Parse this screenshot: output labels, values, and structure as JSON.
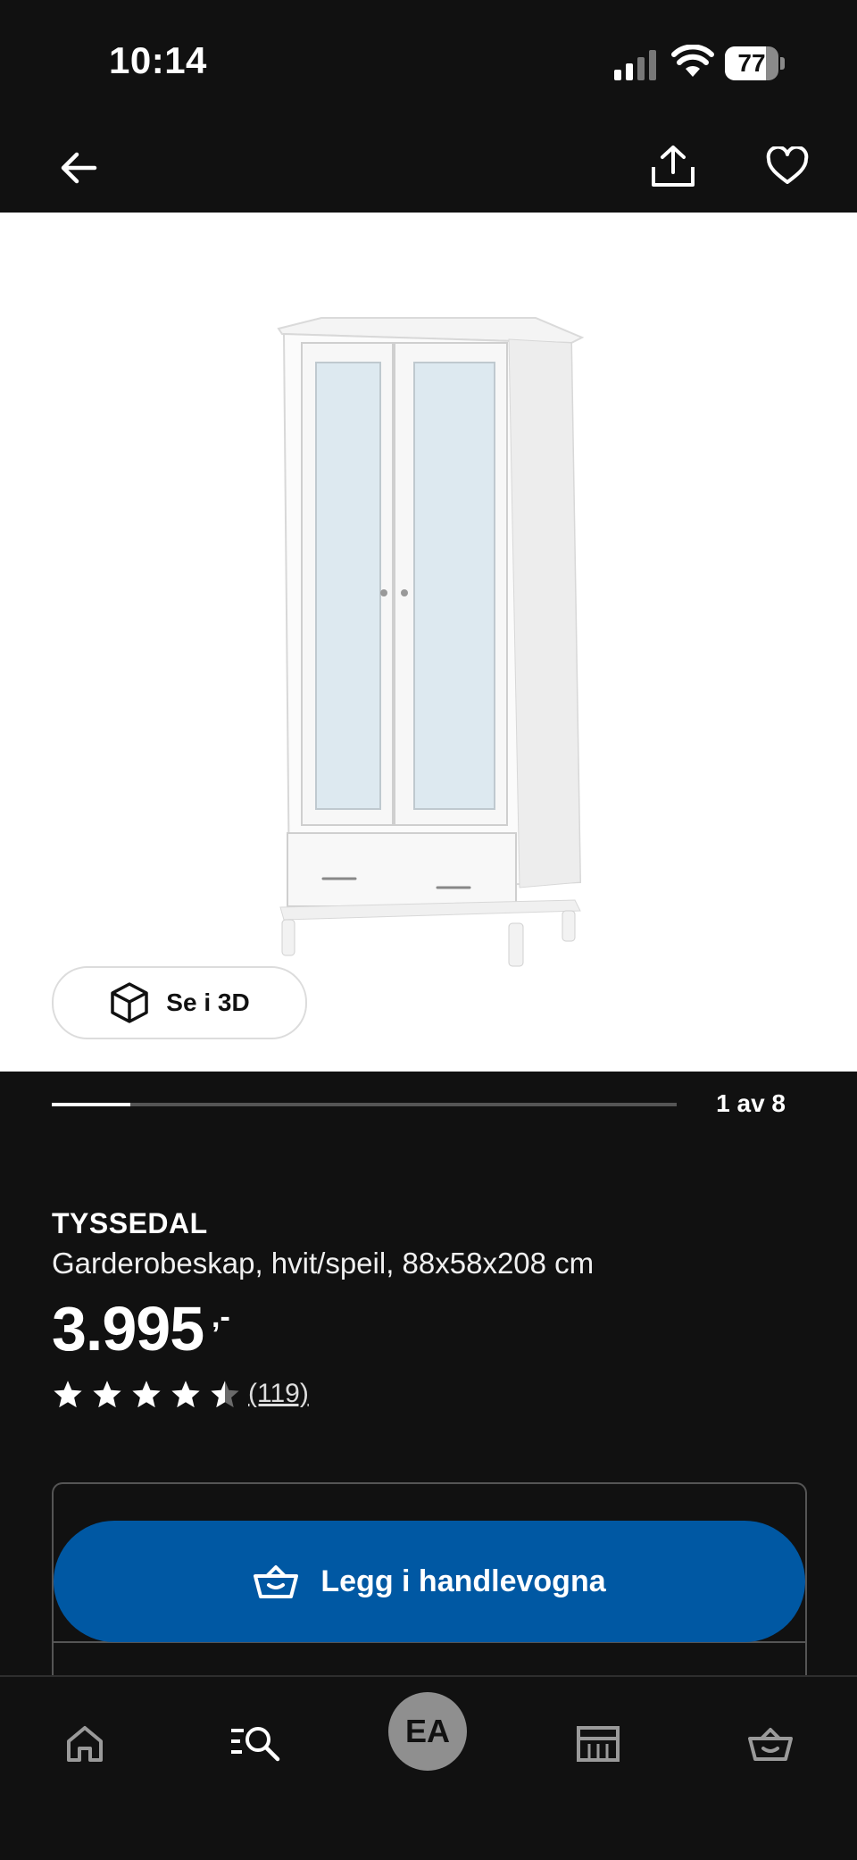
{
  "status_bar": {
    "time": "10:14",
    "battery": "77",
    "battery_level": 0.77
  },
  "nav": {
    "back_icon": "arrow-left-icon",
    "share_icon": "share-icon",
    "favorite_icon": "heart-icon"
  },
  "gallery": {
    "view_3d_label": "Se i 3D",
    "view_3d_icon": "cube-icon",
    "page_indicator": "1 av 8",
    "current_page": 1,
    "total_pages": 8
  },
  "product": {
    "name": "TYSSEDAL",
    "description": "Garderobeskap, hvit/speil, 88x58x208 cm",
    "price": "3.995",
    "price_suffix": ",-",
    "rating": 4.5,
    "rating_max": 5,
    "review_count": "(119)"
  },
  "cart": {
    "button_label": "Legg i handlevogna",
    "button_icon": "basket-icon",
    "button_color": "#0058a3"
  },
  "bottom_nav": {
    "items": [
      {
        "icon": "home-icon"
      },
      {
        "icon": "search-list-icon"
      },
      {
        "icon": "profile-avatar",
        "initials": "EA"
      },
      {
        "icon": "store-icon"
      },
      {
        "icon": "basket-icon"
      }
    ]
  }
}
